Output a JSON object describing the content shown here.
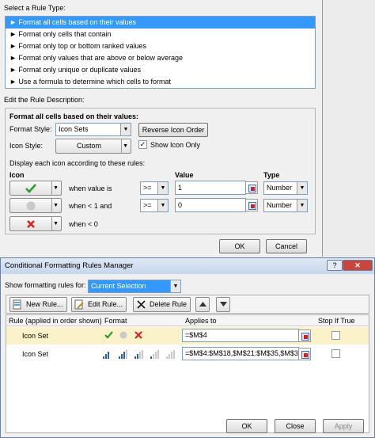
{
  "rule_dialog": {
    "select_type_label": "Select a Rule Type:",
    "rule_types": [
      "► Format all cells based on their values",
      "► Format only cells that contain",
      "► Format only top or bottom ranked values",
      "► Format only values that are above or below average",
      "► Format only unique or duplicate values",
      "► Use a formula to determine which cells to format"
    ],
    "edit_desc_label": "Edit the Rule Description:",
    "section_heading": "Format all cells based on their values:",
    "format_style_label": "Format Style:",
    "format_style_value": "Icon Sets",
    "reverse_btn": "Reverse Icon Order",
    "icon_style_label": "Icon Style:",
    "icon_style_value": "Custom",
    "show_icon_only_label": "Show Icon Only",
    "show_icon_only_checked": true,
    "display_rules_label": "Display each icon according to these rules:",
    "col_icon": "Icon",
    "col_value": "Value",
    "col_type": "Type",
    "rows": [
      {
        "icon": "green-check-icon",
        "condition": "when value is",
        "operator": ">=",
        "value": "1",
        "type": "Number"
      },
      {
        "icon": "gray-circle-icon",
        "condition": "when < 1 and",
        "operator": ">=",
        "value": "0",
        "type": "Number"
      },
      {
        "icon": "red-x-icon",
        "condition": "when < 0"
      }
    ],
    "ok": "OK",
    "cancel": "Cancel"
  },
  "manager": {
    "title": "Conditional Formatting Rules Manager",
    "help": "?",
    "show_rules_for_label": "Show formatting rules for:",
    "show_rules_for_value": "Current Selection",
    "new_rule": "New Rule...",
    "edit_rule": "Edit Rule...",
    "delete_rule": "Delete Rule",
    "col_rule": "Rule (applied in order shown)",
    "col_format": "Format",
    "col_applies": "Applies to",
    "col_stop": "Stop If True",
    "rules": [
      {
        "name": "Icon Set",
        "applies_to": "=$M$4"
      },
      {
        "name": "Icon Set",
        "applies_to": "=$M$4:$M$18,$M$21:$M$35,$M$38:"
      }
    ],
    "ok": "OK",
    "close": "Close",
    "apply": "Apply"
  }
}
